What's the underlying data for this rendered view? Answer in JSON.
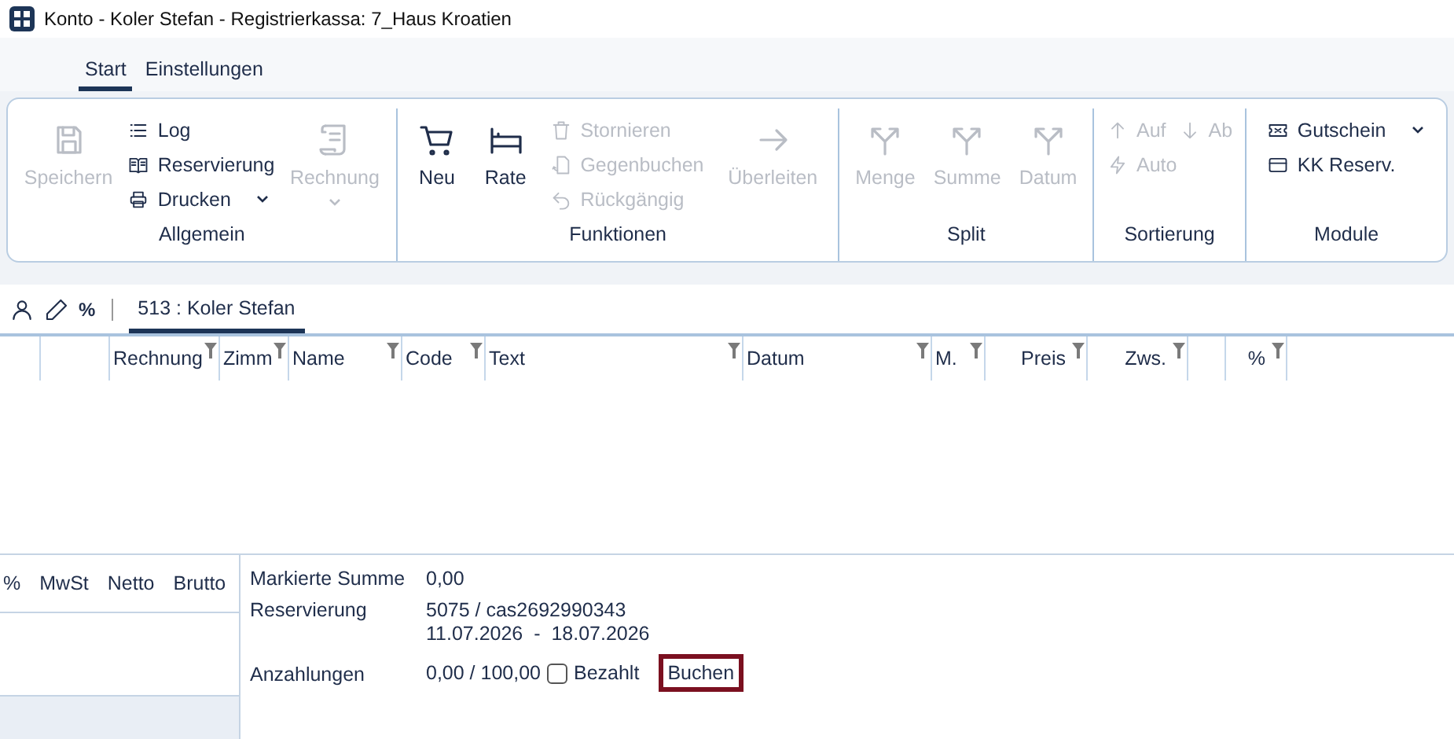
{
  "window": {
    "title": "Konto - Koler Stefan - Registrierkassa: 7_Haus Kroatien"
  },
  "tabs": [
    {
      "label": "Start",
      "selected": true
    },
    {
      "label": "Einstellungen",
      "selected": false
    }
  ],
  "ribbon": {
    "groups": [
      {
        "label": "Allgemein",
        "columns": [
          {
            "kind": "large",
            "label": "Speichern",
            "disabled": true,
            "dropdown": false
          },
          {
            "kind": "stack",
            "rows": [
              [
                {
                  "label": "Log",
                  "disabled": false,
                  "dropdown": false
                }
              ],
              [
                {
                  "label": "Reservierung",
                  "disabled": false,
                  "dropdown": false
                }
              ],
              [
                {
                  "label": "Drucken",
                  "disabled": false,
                  "dropdown": true
                }
              ]
            ]
          },
          {
            "kind": "large",
            "label": "Rechnung",
            "disabled": true,
            "dropdown": true
          }
        ]
      },
      {
        "label": "Funktionen",
        "columns": [
          {
            "kind": "large",
            "label": "Neu",
            "disabled": false,
            "dropdown": false
          },
          {
            "kind": "large",
            "label": "Rate",
            "disabled": false,
            "dropdown": false
          },
          {
            "kind": "stack",
            "rows": [
              [
                {
                  "label": "Stornieren",
                  "disabled": true,
                  "dropdown": false
                }
              ],
              [
                {
                  "label": "Gegenbuchen",
                  "disabled": true,
                  "dropdown": false
                }
              ],
              [
                {
                  "label": "Rückgängig",
                  "disabled": true,
                  "dropdown": false
                }
              ]
            ]
          },
          {
            "kind": "large",
            "label": "Überleiten",
            "disabled": true,
            "dropdown": false
          }
        ]
      },
      {
        "label": "Split",
        "columns": [
          {
            "kind": "large",
            "label": "Menge",
            "disabled": true,
            "dropdown": false
          },
          {
            "kind": "large",
            "label": "Summe",
            "disabled": true,
            "dropdown": false
          },
          {
            "kind": "large",
            "label": "Datum",
            "disabled": true,
            "dropdown": false
          }
        ]
      },
      {
        "label": "Sortierung",
        "columns": [
          {
            "kind": "stack",
            "rows": [
              [
                {
                  "label": "Auf",
                  "disabled": true,
                  "dropdown": false
                },
                {
                  "label": "Ab",
                  "disabled": true,
                  "dropdown": false
                }
              ],
              [
                {
                  "label": "Auto",
                  "disabled": true,
                  "dropdown": false
                }
              ]
            ]
          }
        ]
      },
      {
        "label": "Module",
        "columns": [
          {
            "kind": "stack",
            "rows": [
              [
                {
                  "label": "Gutschein",
                  "disabled": false,
                  "dropdown": true
                }
              ],
              [
                {
                  "label": "KK Reserv.",
                  "disabled": false,
                  "dropdown": false
                }
              ]
            ]
          }
        ]
      }
    ]
  },
  "record_bar": {
    "percent": "%",
    "tabs": [
      {
        "label": "513 : Koler Stefan",
        "selected": true
      }
    ]
  },
  "grid": {
    "columns": [
      {
        "filter": false
      },
      {
        "filter": false
      },
      {
        "label": "Rechnung",
        "filter": true
      },
      {
        "label": "Zimm",
        "filter": true
      },
      {
        "label": "Name",
        "filter": true
      },
      {
        "label": "Code",
        "filter": true
      },
      {
        "label": "Text",
        "filter": true
      },
      {
        "label": "Datum",
        "filter": true
      },
      {
        "label": "M.",
        "filter": true
      },
      {
        "label": "Preis",
        "filter": true
      },
      {
        "label": "Zws.",
        "filter": true
      },
      {
        "filter": false
      },
      {
        "label": "%",
        "filter": true
      }
    ]
  },
  "vat_table": {
    "columns": [
      "%",
      "MwSt",
      "Netto",
      "Brutto"
    ]
  },
  "summary": {
    "marked": {
      "label": "Markierte Summe",
      "value": "0,00"
    },
    "reservation": {
      "label": "Reservierung",
      "lines": [
        "5075 / cas2692990343",
        "11.07.2026  -  18.07.2026"
      ]
    },
    "deposits": {
      "label": "Anzahlungen",
      "value": "0,00 / 100,00",
      "paid": {
        "label": "Bezahlt",
        "checked": false
      },
      "button": {
        "label": "Buchen",
        "highlighted": true
      }
    }
  }
}
